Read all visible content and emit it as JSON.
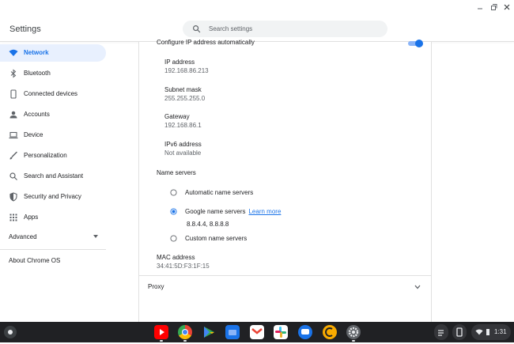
{
  "header": {
    "title": "Settings",
    "search_placeholder": "Search settings"
  },
  "sidebar": {
    "items": [
      {
        "label": "Network",
        "icon": "wifi-icon",
        "active": true
      },
      {
        "label": "Bluetooth",
        "icon": "bluetooth-icon"
      },
      {
        "label": "Connected devices",
        "icon": "phone-icon"
      },
      {
        "label": "Accounts",
        "icon": "person-icon"
      },
      {
        "label": "Device",
        "icon": "laptop-icon"
      },
      {
        "label": "Personalization",
        "icon": "brush-icon"
      },
      {
        "label": "Search and Assistant",
        "icon": "search-icon"
      },
      {
        "label": "Security and Privacy",
        "icon": "shield-icon"
      },
      {
        "label": "Apps",
        "icon": "apps-grid-icon"
      }
    ],
    "advanced_label": "Advanced",
    "about_label": "About Chrome OS"
  },
  "network": {
    "auto_ip_label": "Configure IP address automatically",
    "auto_ip_enabled": true,
    "fields": [
      {
        "label": "IP address",
        "value": "192.168.86.213"
      },
      {
        "label": "Subnet mask",
        "value": "255.255.255.0"
      },
      {
        "label": "Gateway",
        "value": "192.168.86.1"
      },
      {
        "label": "IPv6 address",
        "value": "Not available"
      }
    ],
    "name_servers": {
      "title": "Name servers",
      "options": [
        {
          "label": "Automatic name servers",
          "selected": false
        },
        {
          "label": "Google name servers",
          "selected": true,
          "link": "Learn more"
        },
        {
          "label": "Custom name servers",
          "selected": false
        }
      ],
      "google_servers_value": "8.8.4.4, 8.8.8.8"
    },
    "mac": {
      "label": "MAC address",
      "value": "34:41:5D:F3:1F:15"
    },
    "proxy_label": "Proxy"
  },
  "shelf": {
    "apps": [
      "youtube-icon",
      "chrome-icon",
      "play-store-icon",
      "files-icon",
      "gmail-icon",
      "slack-icon",
      "messages-icon",
      "c-app-icon",
      "settings-icon"
    ],
    "clock": "1:31"
  },
  "colors": {
    "accent": "#1a73e8",
    "active_bg": "#e8f0fe",
    "shelf": "#202124"
  }
}
